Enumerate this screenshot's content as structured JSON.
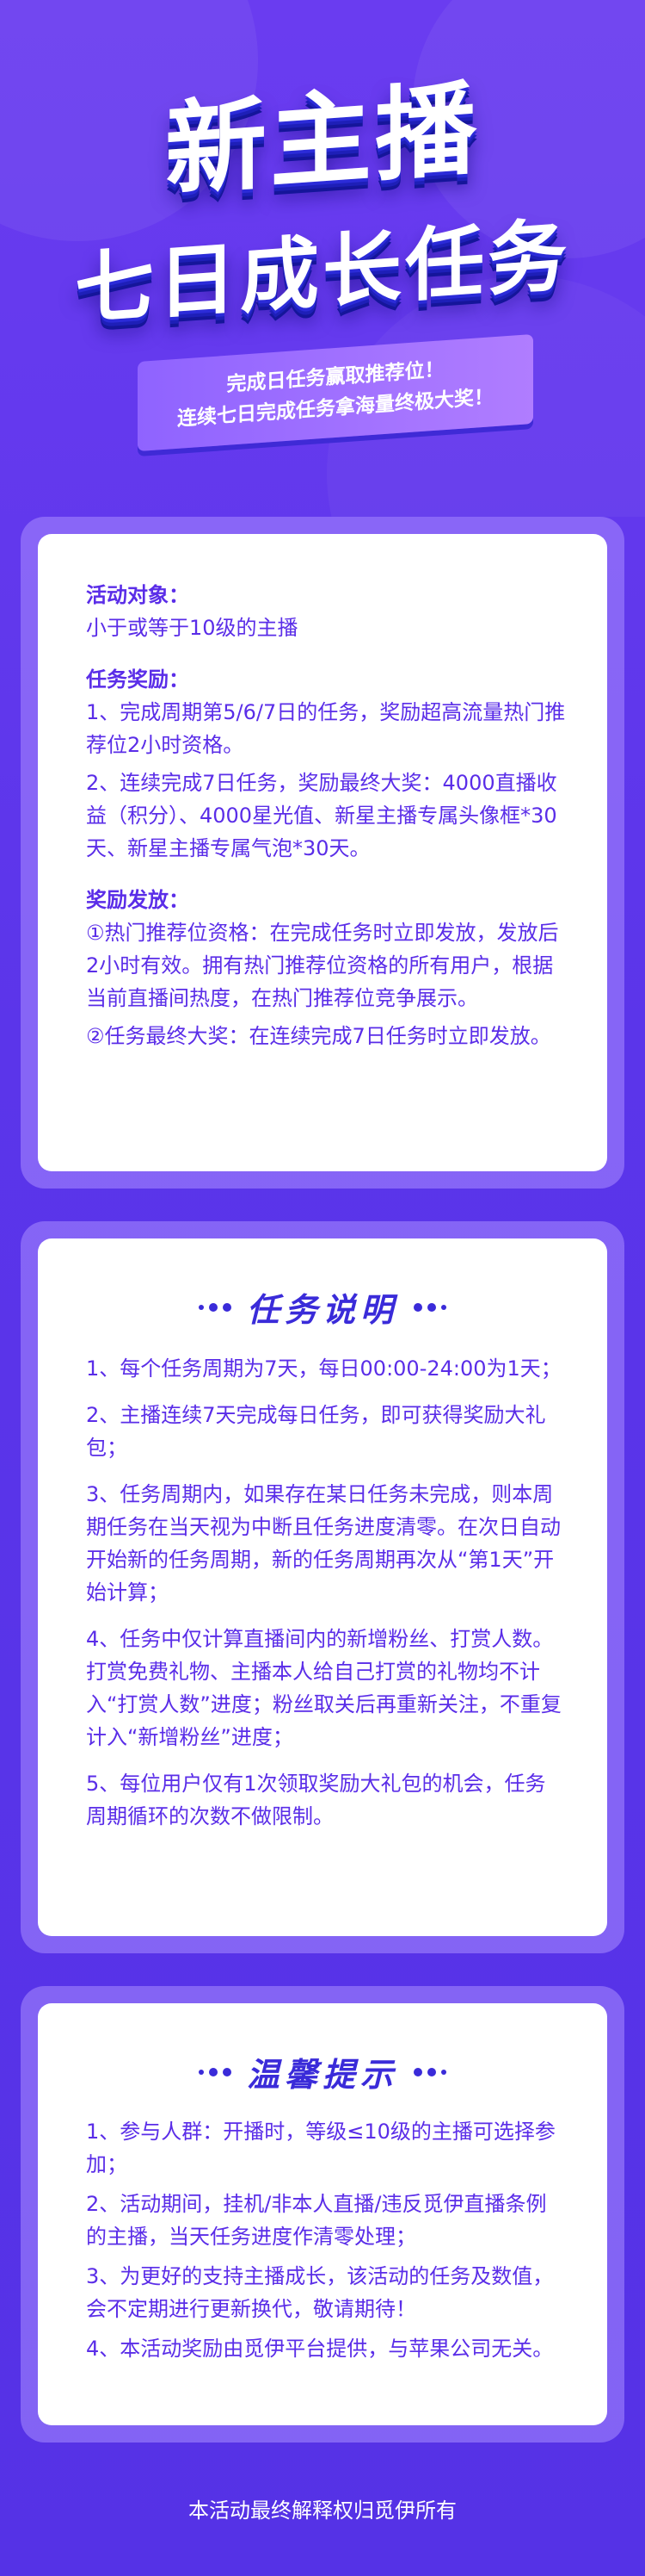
{
  "hero": {
    "title_line1": "新主播",
    "title_line2": "七日成长任务",
    "banner_line1": "完成日任务赢取推荐位！",
    "banner_line2": "连续七日完成任务拿海量终极大奖！"
  },
  "activity": {
    "target_heading": "活动对象：",
    "target_text": "小于或等于10级的主播",
    "reward_heading": "任务奖励：",
    "reward_items": [
      "1、完成周期第5/6/7日的任务，奖励超高流量热门推荐位2小时资格。",
      "2、连续完成7日任务，奖励最终大奖：4000直播收益（积分）、4000星光值、新星主播专属头像框*30天、新星主播专属气泡*30天。"
    ],
    "distribution_heading": "奖励发放：",
    "distribution_items": [
      "①热门推荐位资格：在完成任务时立即发放，发放后2小时有效。拥有热门推荐位资格的所有用户，根据当前直播间热度，在热门推荐位竞争展示。",
      "②任务最终大奖：在连续完成7日任务时立即发放。"
    ]
  },
  "task_desc": {
    "title": "任务说明",
    "items": [
      "1、每个任务周期为7天，每日00:00-24:00为1天；",
      "2、主播连续7天完成每日任务，即可获得奖励大礼包；",
      "3、任务周期内，如果存在某日任务未完成，则本周期任务在当天视为中断且任务进度清零。在次日自动开始新的任务周期，新的任务周期再次从“第1天”开始计算；",
      "4、任务中仅计算直播间内的新增粉丝、打赏人数。打赏免费礼物、主播本人给自己打赏的礼物均不计入“打赏人数”进度；粉丝取关后再重新关注，不重复计入“新增粉丝”进度；",
      "5、每位用户仅有1次领取奖励大礼包的机会，任务周期循环的次数不做限制。"
    ]
  },
  "tips": {
    "title": "温馨提示",
    "items": [
      "1、参与人群：开播时，等级≤10级的主播可选择参加；",
      "2、活动期间，挂机/非本人直播/违反觅伊直播条例的主播，当天任务进度作清零处理；",
      "3、为更好的支持主播成长，该活动的任务及数值，会不定期进行更新换代，敬请期待！",
      "4、本活动奖励由觅伊平台提供，与苹果公司无关。"
    ]
  },
  "footer": {
    "text": "本活动最终解释权归觅伊所有"
  }
}
